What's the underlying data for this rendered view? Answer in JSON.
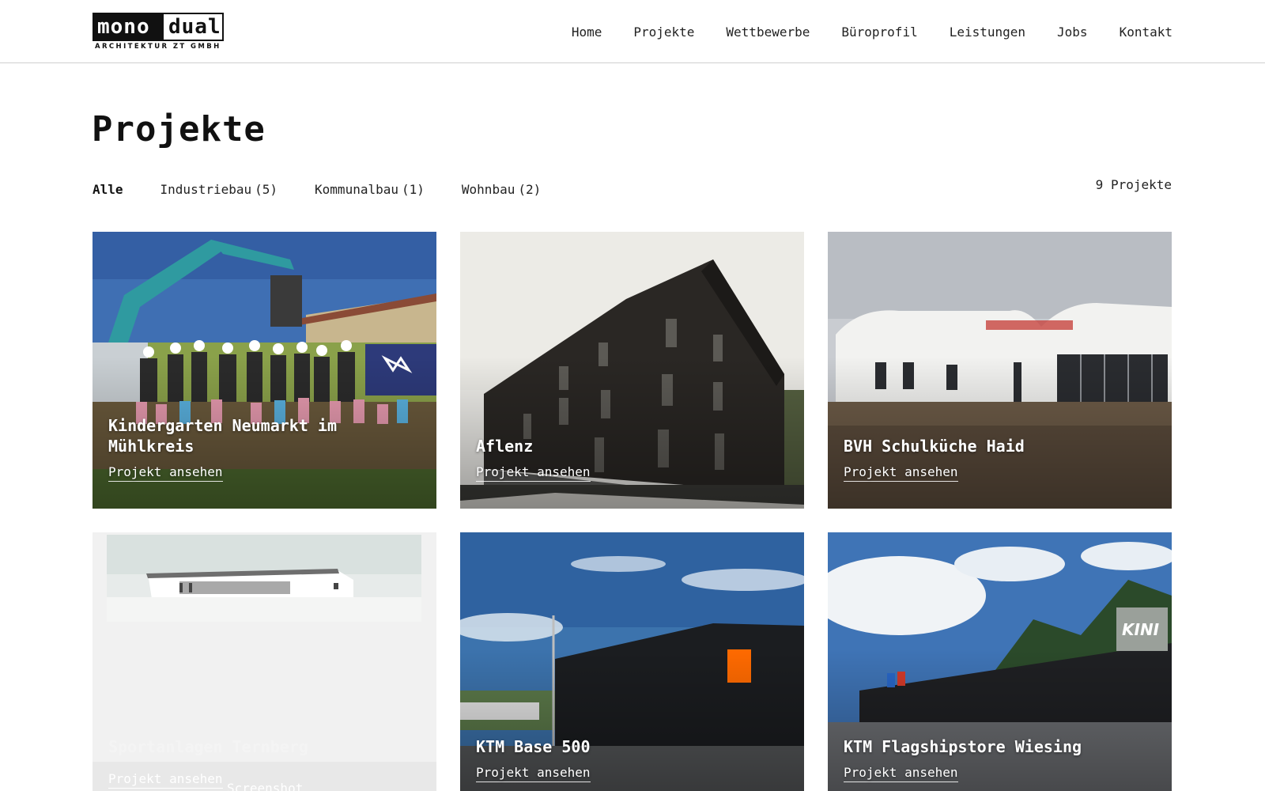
{
  "header": {
    "logo": {
      "word1": "mono",
      "word2": "dual",
      "subtitle": "ARCHITEKTUR ZT GMBH"
    },
    "nav": [
      "Home",
      "Projekte",
      "Wettbewerbe",
      "Büroprofil",
      "Leistungen",
      "Jobs",
      "Kontakt"
    ]
  },
  "main": {
    "title": "Projekte",
    "filters": [
      {
        "label": "Alle",
        "count": "",
        "active": true
      },
      {
        "label": "Industriebau",
        "count": "(5)",
        "active": false
      },
      {
        "label": "Kommunalbau",
        "count": "(1)",
        "active": false
      },
      {
        "label": "Wohnbau",
        "count": "(2)",
        "active": false
      }
    ],
    "project_count": "9 Projekte",
    "projects": [
      {
        "title": "Kindergarten Neumarkt im Mühlkreis",
        "link": "Projekt ansehen",
        "image": "groundbreaking-ceremony-photo"
      },
      {
        "title": "Aflenz",
        "link": "Projekt ansehen",
        "image": "dark-timber-residential-building-photo"
      },
      {
        "title": "BVH Schulküche Haid",
        "link": "Projekt ansehen",
        "image": "white-curved-school-building-photo"
      },
      {
        "title": "Sportanlagen Ternberg",
        "link": "Projekt ansehen",
        "caption": "Screenshot",
        "image": "sports-hall-rendering"
      },
      {
        "title": "KTM Base 500",
        "link": "Projekt ansehen",
        "image": "black-industrial-hall-photo"
      },
      {
        "title": "KTM Flagshipstore Wiesing",
        "link": "Projekt ansehen",
        "image": "flagship-store-facade-photo"
      }
    ]
  },
  "colors": {
    "accent_orange": "#ff6a00",
    "sky_blue": "#3f6fb3",
    "logo_black": "#111111"
  }
}
